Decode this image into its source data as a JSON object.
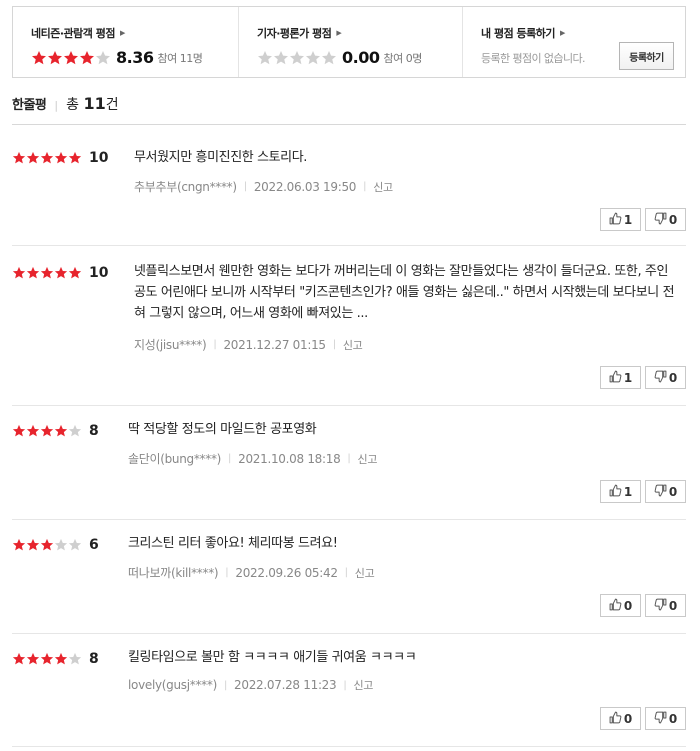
{
  "rating_box": {
    "netizen": {
      "title": "네티즌·관람객 평점",
      "score": "8.36",
      "participants": "참여 11명",
      "stars": 4
    },
    "critic": {
      "title": "기자·평론가 평점",
      "score": "0.00",
      "participants": "참여 0명",
      "stars": 0
    },
    "mine": {
      "title": "내 평점 등록하기",
      "empty_text": "등록한 평점이 없습니다.",
      "register_label": "등록하기"
    }
  },
  "colors": {
    "star_on": "#e7242d",
    "star_off": "#cfcfcf"
  },
  "list": {
    "title": "한줄평",
    "total_prefix": "총",
    "total_count": "11",
    "total_suffix": "건"
  },
  "reviews": [
    {
      "stars": 5,
      "score": "10",
      "text": "무서웠지만 흥미진진한 스토리다.",
      "author": "추부추부(cngn****)",
      "date": "2022.06.03 19:50",
      "report": "신고",
      "likes": "1",
      "dislikes": "0"
    },
    {
      "stars": 5,
      "score": "10",
      "text": "넷플릭스보면서 웬만한 영화는 보다가 꺼버리는데 이 영화는 잘만들었다는 생각이 들더군요. 또한, 주인공도 어린애다 보니까 시작부터 \"키즈콘텐츠인가? 애들 영화는 싫은데..\" 하면서 시작했는데 보다보니 전혀 그렇지 않으며, 어느새 영화에 빠져있는 ...",
      "author": "지성(jisu****)",
      "date": "2021.12.27 01:15",
      "report": "신고",
      "likes": "1",
      "dislikes": "0"
    },
    {
      "stars": 4,
      "score": "8",
      "text": "딱 적당할 정도의 마일드한 공포영화",
      "author": "솔단이(bung****)",
      "date": "2021.10.08 18:18",
      "report": "신고",
      "likes": "1",
      "dislikes": "0"
    },
    {
      "stars": 3,
      "score": "6",
      "text": "크리스틴 리터 좋아요! 체리따봉 드려요!",
      "author": "떠나보까(kill****)",
      "date": "2022.09.26 05:42",
      "report": "신고",
      "likes": "0",
      "dislikes": "0"
    },
    {
      "stars": 4,
      "score": "8",
      "text": "킬링타임으로 볼만 함 ㅋㅋㅋㅋ 애기들 귀여움 ㅋㅋㅋㅋ",
      "author": "lovely(gusj****)",
      "date": "2022.07.28 11:23",
      "report": "신고",
      "likes": "0",
      "dislikes": "0"
    }
  ]
}
